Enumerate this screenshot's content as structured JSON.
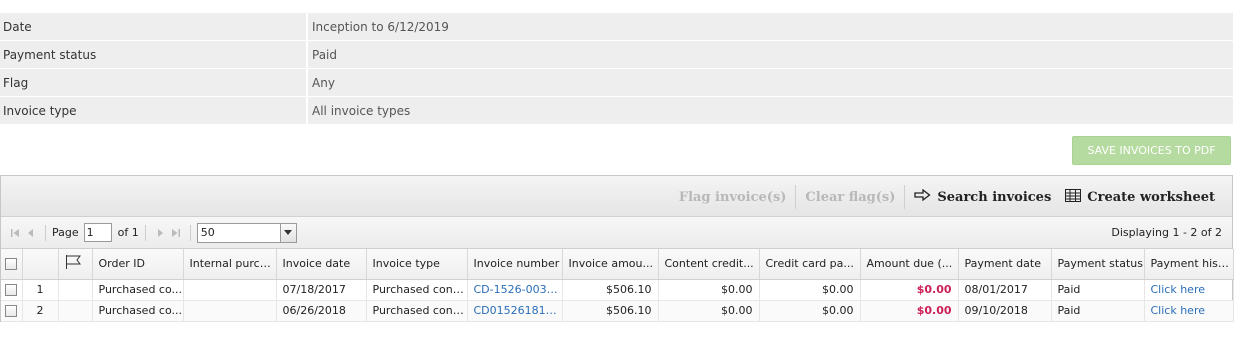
{
  "filters": [
    {
      "label": "Date",
      "value": "Inception to 6/12/2019"
    },
    {
      "label": "Payment status",
      "value": "Paid"
    },
    {
      "label": "Flag",
      "value": "Any"
    },
    {
      "label": "Invoice type",
      "value": "All invoice types"
    }
  ],
  "save_pdf_label": "SAVE INVOICES TO PDF",
  "toolbar": {
    "flag_label": "Flag invoice(s)",
    "clear_flag_label": "Clear flag(s)",
    "search_label": "Search invoices",
    "worksheet_label": "Create worksheet"
  },
  "pager": {
    "page_label": "Page",
    "page_value": "1",
    "of_label": "of 1",
    "page_size": "50",
    "display_text": "Displaying 1 - 2 of 2"
  },
  "columns": [
    "Order ID",
    "Internal purch...",
    "Invoice date",
    "Invoice type",
    "Invoice number",
    "Invoice amou...",
    "Content credit...",
    "Credit card pa...",
    "Amount due (...",
    "Payment date",
    "Payment status",
    "Payment history"
  ],
  "rows": [
    {
      "num": "1",
      "order_id": "Purchased co...",
      "internal": "",
      "invoice_date": "07/18/2017",
      "invoice_type": "Purchased cont...",
      "invoice_number": "CD-1526-0036...",
      "invoice_amount": "$506.10",
      "content_credit": "$0.00",
      "credit_card": "$0.00",
      "amount_due": "$0.00",
      "payment_date": "08/01/2017",
      "payment_status": "Paid",
      "history": "Click here"
    },
    {
      "num": "2",
      "order_id": "Purchased co...",
      "internal": "",
      "invoice_date": "06/26/2018",
      "invoice_type": "Purchased cont...",
      "invoice_number": "CD015261811...",
      "invoice_amount": "$506.10",
      "content_credit": "$0.00",
      "credit_card": "$0.00",
      "amount_due": "$0.00",
      "payment_date": "09/10/2018",
      "payment_status": "Paid",
      "history": "Click here"
    }
  ],
  "colors": {
    "accent_green": "#b6dba0",
    "amount_due_red": "#cc1f55",
    "link_blue": "#2a6eb8"
  }
}
